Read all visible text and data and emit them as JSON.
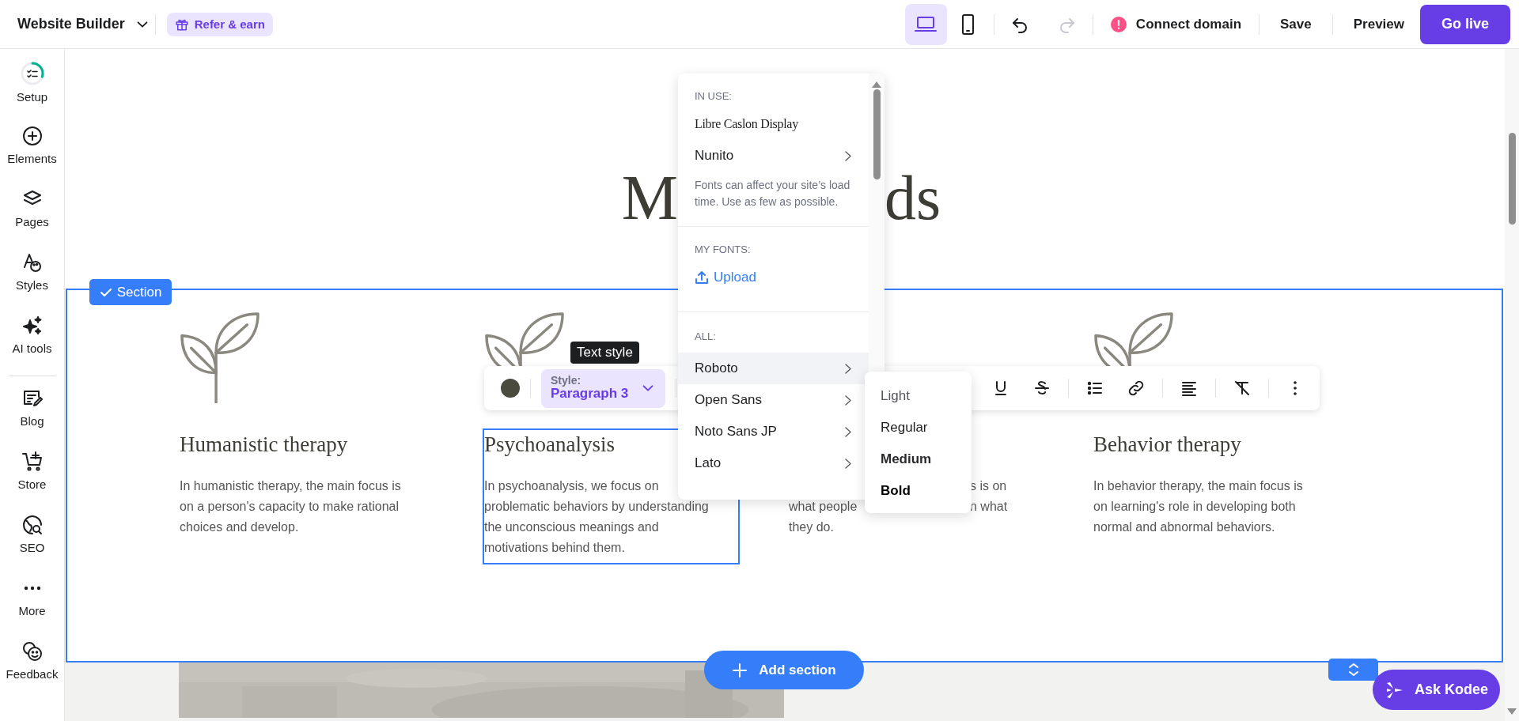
{
  "topbar": {
    "title": "Website Builder",
    "refer": "Refer & earn",
    "devices": [
      {
        "kind": "desktop",
        "selected": true
      },
      {
        "kind": "mobile",
        "selected": false
      }
    ],
    "history": [
      {
        "kind": "undo",
        "disabled": false
      },
      {
        "kind": "redo",
        "disabled": true
      }
    ],
    "domain": {
      "label": "Connect domain",
      "alert": true
    },
    "actions": [
      {
        "label": "Save",
        "kind": "plain"
      },
      {
        "label": "Preview",
        "kind": "plain"
      },
      {
        "label": "Go live",
        "kind": "primary"
      }
    ]
  },
  "sidebar": {
    "groups": [
      [
        {
          "label": "Setup",
          "kind": "setup"
        },
        {
          "label": "Elements",
          "kind": "elements"
        },
        {
          "label": "Pages",
          "kind": "pages"
        },
        {
          "label": "Styles",
          "kind": "styles"
        },
        {
          "label": "AI tools",
          "kind": "ai"
        }
      ],
      [
        {
          "label": "Blog",
          "kind": "blog"
        },
        {
          "label": "Store",
          "kind": "store"
        },
        {
          "label": "SEO",
          "kind": "seo"
        },
        {
          "label": "More",
          "kind": "more"
        },
        {
          "label": "Feedback",
          "kind": "feedback"
        }
      ]
    ]
  },
  "canvas": {
    "heading_parts": [
      "M",
      "ds"
    ],
    "section_badge": "Section",
    "columns": [
      {
        "kind": "full",
        "selected": false,
        "title": "Humanistic therapy",
        "lines": [
          "In humanistic therapy, the main focus is",
          "on a person's capacity to make rational",
          "choices and develop."
        ]
      },
      {
        "kind": "full",
        "selected": true,
        "title": "Psychoanalysis",
        "lines": [
          "In psychoanalysis, we focus on",
          "problematic behaviors by understanding",
          "the unconscious meanings and",
          "motivations behind them."
        ]
      },
      {
        "kind": "partial",
        "selected": false,
        "lines": [
          {
            "right": "s is on"
          },
          {
            "left": "what people",
            "right": "n what"
          },
          {
            "left": "they do."
          }
        ]
      },
      {
        "kind": "full",
        "selected": false,
        "title": "Behavior therapy",
        "lines": [
          "In behavior therapy, the main focus is",
          "on learning's role in developing both",
          "normal and abnormal behaviors."
        ]
      }
    ],
    "add_section": "Add section",
    "assistant": "Ask Kodee"
  },
  "toolbar": {
    "tooltip": "Text style",
    "style_label": "Style:",
    "style_value": "Paragraph 3"
  },
  "font_menu": {
    "sections": [
      {
        "heading": "IN USE:",
        "items": [
          {
            "label": "Libre Caslon Display",
            "kind": "serif",
            "submenu": false,
            "selected": false
          },
          {
            "label": "Nunito",
            "kind": "sans",
            "submenu": true,
            "selected": false
          }
        ],
        "note": "Fonts can affect your site’s load time. Use as few as possible."
      },
      {
        "heading": "MY FONTS:",
        "upload": "Upload"
      },
      {
        "heading": "ALL:",
        "items": [
          {
            "label": "Roboto",
            "kind": "sans",
            "submenu": true,
            "selected": true
          },
          {
            "label": "Open Sans",
            "kind": "sans",
            "submenu": true,
            "selected": false
          },
          {
            "label": "Noto Sans JP",
            "kind": "sans",
            "submenu": true,
            "selected": false
          },
          {
            "label": "Lato",
            "kind": "sans",
            "submenu": true,
            "selected": false
          }
        ]
      }
    ]
  },
  "weight_menu": [
    {
      "label": "Light",
      "kind": "light"
    },
    {
      "label": "Regular",
      "kind": "regular"
    },
    {
      "label": "Medium",
      "kind": "medium"
    },
    {
      "label": "Bold",
      "kind": "bold"
    }
  ]
}
